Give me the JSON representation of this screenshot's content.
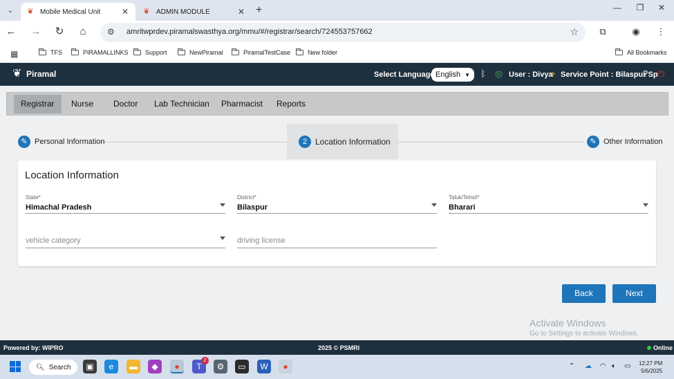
{
  "browser": {
    "tabs": [
      {
        "title": "Mobile Medical Unit",
        "active": true
      },
      {
        "title": "ADMIN MODULE",
        "active": false
      }
    ],
    "url": "amritwprdev.piramalswasthya.org/mmu/#/registrar/search/724553757662",
    "bookmarks": [
      "TFS",
      "PIRAMALLINKS",
      "Support",
      "NewPiramal",
      "PiramalTestCase",
      "New folder"
    ],
    "all_bookmarks": "All Bookmarks"
  },
  "header": {
    "logo_text": "Piramal",
    "select_language_label": "Select Language:",
    "language": "English",
    "user": "User : Divya",
    "service_point": "Service Point : Bilaspur Sp"
  },
  "roles": [
    "Registrar",
    "Nurse",
    "Doctor",
    "Lab Technician",
    "Pharmacist",
    "Reports"
  ],
  "stepper": {
    "step1": "Personal Information",
    "step2_num": "2",
    "step2": "Location Information",
    "step3": "Other Information"
  },
  "form": {
    "title": "Location Information",
    "state_label": "State*",
    "state_value": "Himachal Pradesh",
    "district_label": "District*",
    "district_value": "Bilaspur",
    "taluk_label": "Taluk/Tehsil*",
    "taluk_value": "Bharari",
    "vehicle_placeholder": "vehicle category",
    "license_placeholder": "driving license"
  },
  "buttons": {
    "back": "Back",
    "next": "Next"
  },
  "watermark": {
    "line1": "Activate Windows",
    "line2": "Go to Settings to activate Windows."
  },
  "footer": {
    "powered": "Powered by: WIPRO",
    "copyright": "2025 © PSMRI",
    "status": "Online"
  },
  "taskbar": {
    "search": "Search",
    "time": "12:27 PM",
    "date": "5/6/2025",
    "teams_badge": "2"
  },
  "colors": {
    "primary": "#1f75b9",
    "header_bg": "#1e2f3d"
  }
}
